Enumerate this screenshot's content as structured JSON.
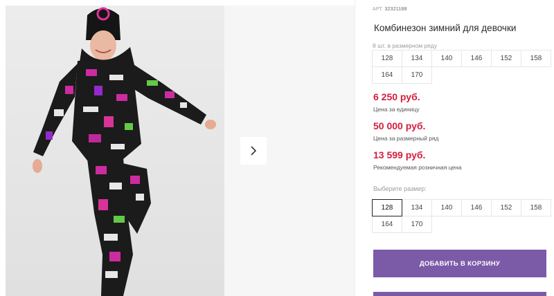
{
  "product": {
    "article_label": "АРТ.",
    "article_code": "32321188",
    "title": "Комбинезон зимний для девочки",
    "sizes_note": "8 шт. в размерном ряду",
    "sizes_row": [
      "128",
      "134",
      "140",
      "146",
      "152",
      "158",
      "164",
      "170"
    ]
  },
  "prices": [
    {
      "value": "6 250 руб.",
      "label": "Цена за единицу"
    },
    {
      "value": "50 000 руб.",
      "label": "Цена за размерный ряд"
    },
    {
      "value": "13 599 руб.",
      "label": "Рекомендуемая розничная цена"
    }
  ],
  "size_select": {
    "label": "Выберите размер:",
    "options": [
      "128",
      "134",
      "140",
      "146",
      "152",
      "158",
      "164",
      "170"
    ],
    "selected": "128"
  },
  "actions": {
    "add_to_cart": "ДОБАВИТЬ В КОРЗИНУ"
  },
  "colors": {
    "accent": "#7b5ba8",
    "price": "#d21f3c"
  },
  "icons": {
    "next": "chevron-right-icon"
  }
}
